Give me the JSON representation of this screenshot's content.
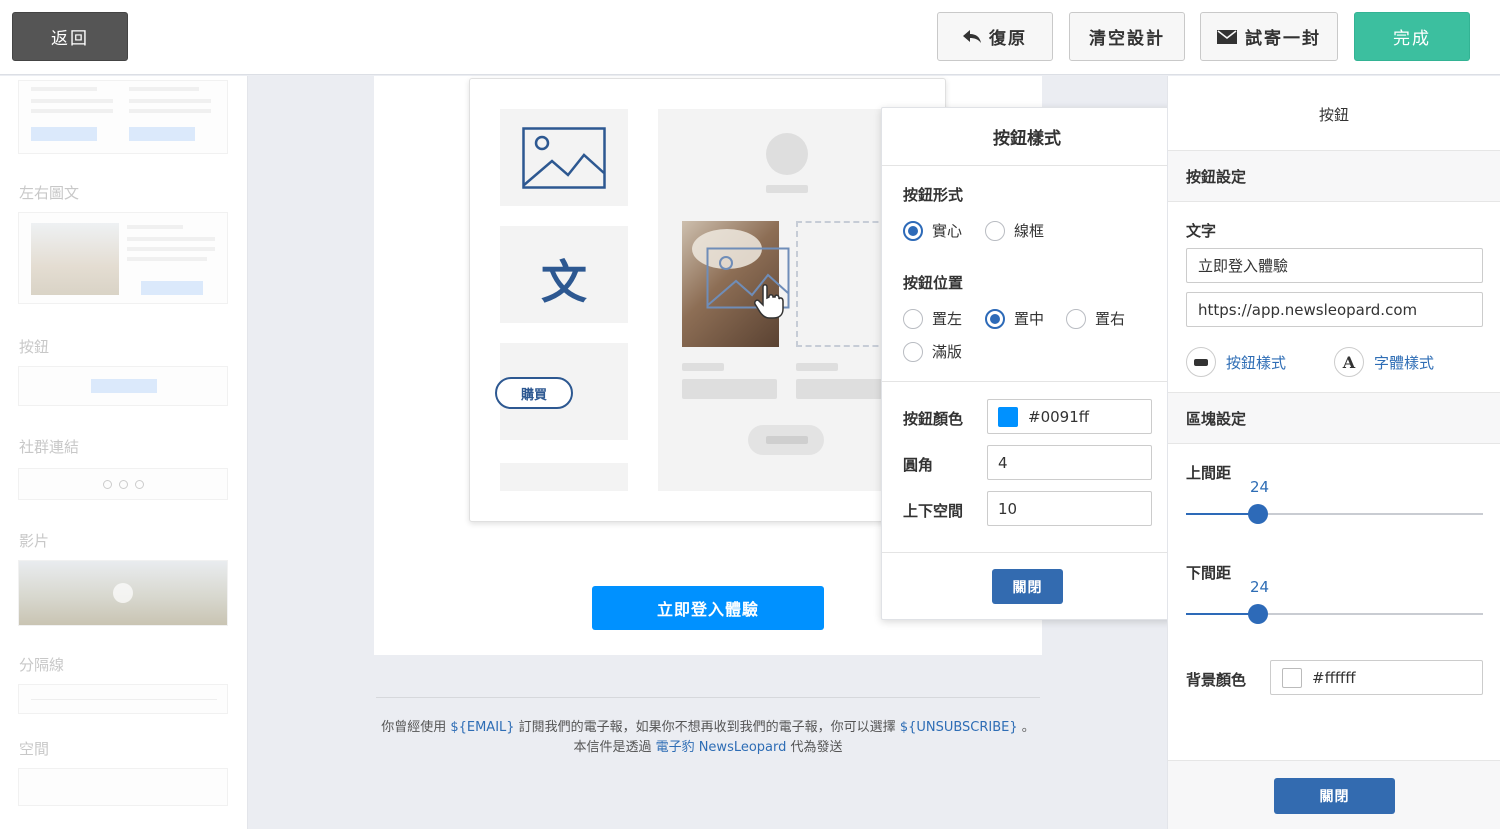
{
  "toolbar": {
    "back_label": "返回",
    "undo_label": "復原",
    "clear_label": "清空設計",
    "test_send_label": "試寄一封",
    "done_label": "完成"
  },
  "sidebar": {
    "sections": [
      "左右圖文",
      "按鈕",
      "社群連結",
      "影片",
      "分隔線",
      "空間"
    ]
  },
  "canvas": {
    "illustration": {
      "text_glyph": "文",
      "buy_label": "購買"
    },
    "cta_label": "立即登入體驗"
  },
  "footer": {
    "line1_a": "你曾經使用 ",
    "email_var": "${EMAIL}",
    "line1_b": " 訂閱我們的電子報，如果你不想再收到我們的電子報，你可以選擇 ",
    "unsubscribe_var": "${UNSUBSCRIBE}",
    "line1_c": " 。",
    "line2_a": "本信件是透過 ",
    "brand_link": "電子豹 NewsLeopard",
    "line2_b": " 代為發送"
  },
  "popup": {
    "title": "按鈕樣式",
    "form_label": "按鈕形式",
    "form_options": [
      "實心",
      "線框"
    ],
    "form_selected": "實心",
    "position_label": "按鈕位置",
    "position_options": [
      "置左",
      "置中",
      "置右",
      "滿版"
    ],
    "position_selected": "置中",
    "color_label": "按鈕顏色",
    "color_value": "#0091ff",
    "radius_label": "圓角",
    "radius_value": "4",
    "padding_label": "上下空間",
    "padding_value": "10",
    "close_label": "關閉"
  },
  "right_panel": {
    "title": "按鈕",
    "button_settings_header": "按鈕設定",
    "text_label": "文字",
    "text_value": "立即登入體驗",
    "url_value": "https://app.newsleopard.com",
    "button_style_link": "按鈕樣式",
    "font_style_link": "字體樣式",
    "font_icon_glyph": "A",
    "block_settings_header": "區塊設定",
    "top_padding_label": "上間距",
    "top_padding_value": "24",
    "bottom_padding_label": "下間距",
    "bottom_padding_value": "24",
    "bg_color_label": "背景顏色",
    "bg_color_value": "#ffffff",
    "close_label": "關閉"
  },
  "colors": {
    "accent": "#2d6ab8",
    "button_color": "#0091ff",
    "done_green": "#3cbf9f"
  },
  "icons": {
    "undo": "reply-arrow-icon",
    "test_send": "envelope-icon",
    "button_style": "button-style-icon",
    "font_style": "font-letter-icon"
  }
}
